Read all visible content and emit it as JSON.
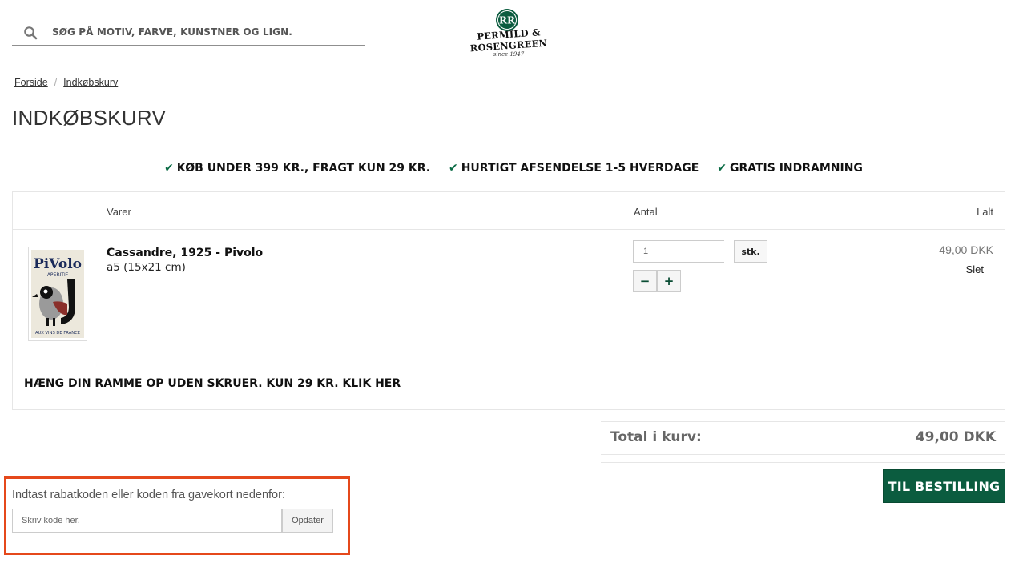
{
  "header": {
    "search_placeholder": "SØG PÅ MOTIV, FARVE, KUNSTNER OG LIGN.",
    "logo_line1": "PERMILD &",
    "logo_line2": "ROSENGREEN",
    "logo_line3": "since 1947",
    "logo_monogram": "RR"
  },
  "breadcrumb": {
    "items": [
      "Forside",
      "Indkøbskurv"
    ],
    "separator": "/"
  },
  "page_title": "INDKØBSKURV",
  "usp": [
    "KØB UNDER 399 KR., FRAGT KUN 29 KR.",
    "HURTIGT AFSENDELSE 1-5 HVERDAGE",
    "GRATIS INDRAMNING"
  ],
  "cart": {
    "headers": {
      "items": "Varer",
      "quantity": "Antal",
      "total": "I alt"
    },
    "line": {
      "name": "Cassandre, 1925 - Pivolo",
      "variant": "a5 (15x21 cm)",
      "quantity": "1",
      "unit": "stk.",
      "minus": "−",
      "plus": "+",
      "price": "49,00 DKK",
      "delete": "Slet",
      "thumb_text_top": "PiVolo",
      "thumb_text_sub": "APERITIF",
      "thumb_text_bottom": "AUX VINS DE FRANCE"
    },
    "upsell_text": "HÆNG DIN RAMME OP UDEN SKRUER.",
    "upsell_link": "KUN 29 KR. KLIK HER"
  },
  "totals": {
    "label": "Total i kurv:",
    "value": "49,00 DKK",
    "checkout": "TIL BESTILLING"
  },
  "discount": {
    "label": "Indtast rabatkoden eller koden fra gavekort nedenfor:",
    "placeholder": "Skriv kode her.",
    "button": "Opdater"
  },
  "colors": {
    "brand_green": "#0b5c3f",
    "check_green": "#0a6b45",
    "highlight_border": "#e5481b"
  },
  "icons": {
    "search": "search-icon",
    "check": "check-icon"
  }
}
